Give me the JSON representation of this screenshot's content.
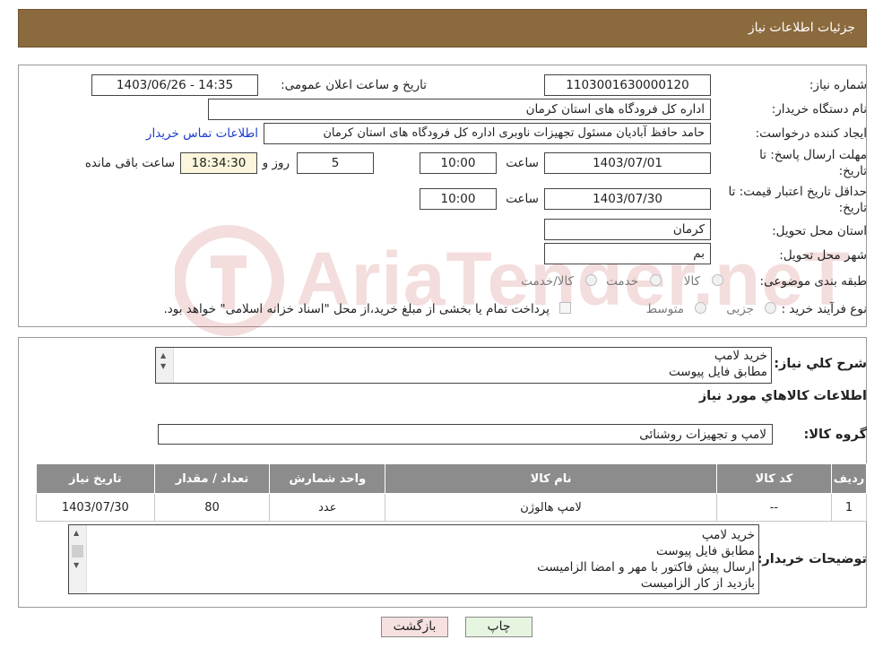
{
  "header": {
    "title": "جزئیات اطلاعات نیاز"
  },
  "fields": {
    "need_number_label": "شماره نیاز:",
    "need_number": "1103001630000120",
    "announce_label": "تاریخ و ساعت اعلان عمومی:",
    "announce_value": "1403/06/26 - 14:35",
    "buyer_org_label": "نام دستگاه خریدار:",
    "buyer_org": "اداره کل فرودگاه های استان کرمان",
    "creator_label": "ایجاد کننده درخواست:",
    "creator": "حامد حافظ آبادیان مسئول تجهیزات ناوبری اداره کل فرودگاه های استان کرمان",
    "contact_link": "اطلاعات تماس خریدار",
    "deadline_label_1": "مهلت ارسال پاسخ: تا",
    "deadline_label_2": "تاریخ:",
    "deadline_date": "1403/07/01",
    "time_label": "ساعت",
    "deadline_time": "10:00",
    "days_value": "5",
    "days_label": "روز و",
    "remaining_time": "18:34:30",
    "remaining_label": "ساعت باقی مانده",
    "validity_label_1": "حداقل تاریخ اعتبار قیمت: تا",
    "validity_label_2": "تاریخ:",
    "validity_date": "1403/07/30",
    "validity_time": "10:00",
    "province_label": "استان محل تحویل:",
    "province": "کرمان",
    "city_label": "شهر محل تحویل:",
    "city": "بم",
    "category_label": "طبقه بندی موضوعی:",
    "category_options": [
      "کالا",
      "خدمت",
      "کالا/خدمت"
    ],
    "process_label": "نوع فرآیند خرید :",
    "process_options": [
      "جزیی",
      "متوسط"
    ],
    "payment_note": "پرداخت تمام یا بخشی از مبلغ خرید،از محل \"اسناد خزانه اسلامی\" خواهد بود."
  },
  "summary": {
    "label": "شرح کلي نياز:",
    "lines": [
      "خرید لامپ",
      "مطابق فایل پیوست"
    ]
  },
  "goods_section": {
    "title": "اطلاعات کالاهاي مورد نياز",
    "group_label": "گروه کالا:",
    "group_value": "لامپ و تجهیزات روشنائی"
  },
  "table": {
    "headers": [
      "ردیف",
      "کد کالا",
      "نام کالا",
      "واحد شمارش",
      "تعداد / مقدار",
      "تاریخ نیاز"
    ],
    "rows": [
      [
        "1",
        "--",
        "لامپ هالوژن",
        "عدد",
        "80",
        "1403/07/30"
      ]
    ]
  },
  "buyer_notes": {
    "label": "توضیحات خریدار:",
    "lines": [
      "خرید لامپ",
      "مطابق فایل پیوست",
      "ارسال پیش فاکتور با مهر و امضا الزامیست",
      "بازدید از کار الزامیست"
    ]
  },
  "buttons": {
    "print": "چاپ",
    "back": "بازگشت"
  },
  "watermark": {
    "text": "AriaTender.neT"
  },
  "colors": {
    "header_bg": "#8b6a3e",
    "table_header_bg": "#8c8c8c",
    "link": "#1a3ccf",
    "back_button_bg": "#f7e0e0",
    "print_button_bg": "#e6f5e0"
  }
}
